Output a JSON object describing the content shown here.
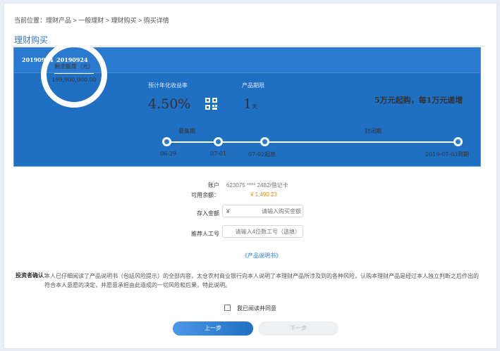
{
  "breadcrumb": "当前位置：理财产品 > 一般理财 > 理财购买 > 购买详情",
  "page_title": "理财购买",
  "product": {
    "code_1": "20190924",
    "code_2": "20190924",
    "remaining_label": "剩余额度（元）",
    "remaining_value": "199,900,000.00",
    "rate_label": "预计年化收益率",
    "rate_value": "4.50%",
    "term_label": "产品期限",
    "term_value": "1",
    "term_unit": "天",
    "slogan": "5万元起购，每1万元递增"
  },
  "timeline": {
    "phase_raise": "募集期",
    "phase_closed": "封闭期",
    "dates": [
      "06-29",
      "07-01",
      "07-02起息",
      "2019-07-03到期"
    ]
  },
  "form": {
    "account_label": "账户",
    "account_value": "623075 **** 2482/借记卡",
    "balance_label": "可用余额：",
    "balance_value": "¥ 1,490.23",
    "amount_label": "存入金额",
    "currency_symbol": "¥",
    "amount_placeholder": "请输入购买金额",
    "referrer_label": "推荐人工号",
    "referrer_placeholder": "请输入4位数工号（选填）"
  },
  "manual_link": "《产品说明书》",
  "confirmation": {
    "title": "投资者确认：",
    "text": "本人已仔细阅读了产品说明书（包括风险提示）的全部内容，太仓农村商业银行向本人说明了本理财产品所涉及到的各种风险，认购本理财产品是经过本人独立判断之后作出的符合本人意愿的决定，并愿意承担由此造成的一切风险和后果，特此说明。"
  },
  "agree_label": "我已阅读并同意",
  "buttons": {
    "prev": "上一步",
    "next": "下一步"
  },
  "colors": {
    "primary": "#1f6fc3",
    "accent": "#f08a00",
    "disabled": "#eef0f2"
  }
}
